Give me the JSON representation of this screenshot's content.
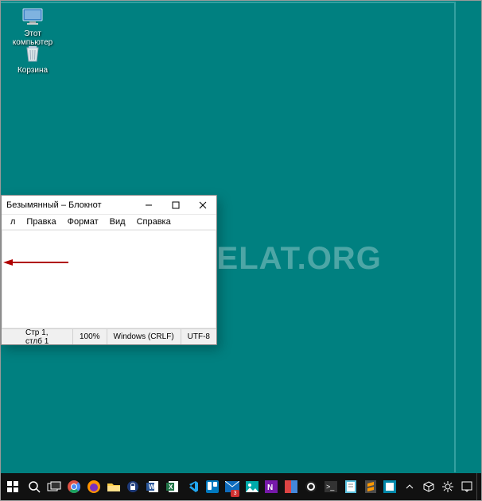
{
  "desktop": {
    "icons": [
      {
        "name": "this-pc",
        "label": "Этот\nкомпьютер"
      },
      {
        "name": "recycle-bin",
        "label": "Корзина"
      }
    ]
  },
  "notepad": {
    "title": "Безымянный – Блокнот",
    "menus": [
      "л",
      "Правка",
      "Формат",
      "Вид",
      "Справка"
    ],
    "content": "",
    "status": {
      "pos": "Стр 1, стлб 1",
      "zoom": "100%",
      "eol": "Windows (CRLF)",
      "enc": "UTF-8"
    }
  },
  "watermark": "KAK-SDELAT.ORG",
  "taskbar_badges": {
    "mail": "3"
  }
}
